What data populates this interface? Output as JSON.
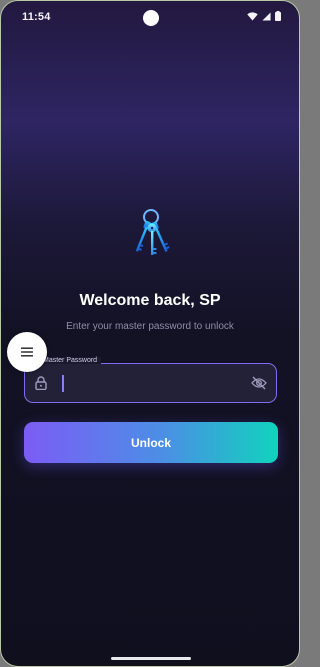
{
  "status_bar": {
    "time": "11:54"
  },
  "unlock_screen": {
    "title": "Welcome back, SP",
    "subtitle": "Enter your master password to unlock",
    "password_field": {
      "label": "Master Password",
      "value": ""
    },
    "unlock_label": "Unlock"
  },
  "icons": {
    "app": "keys-icon",
    "menu": "menu-icon",
    "lock": "lock-icon",
    "visibility": "eye-off-icon"
  },
  "colors": {
    "accent_purple": "#7c6ef2",
    "accent_teal": "#10d3bd",
    "background": "#131225"
  }
}
